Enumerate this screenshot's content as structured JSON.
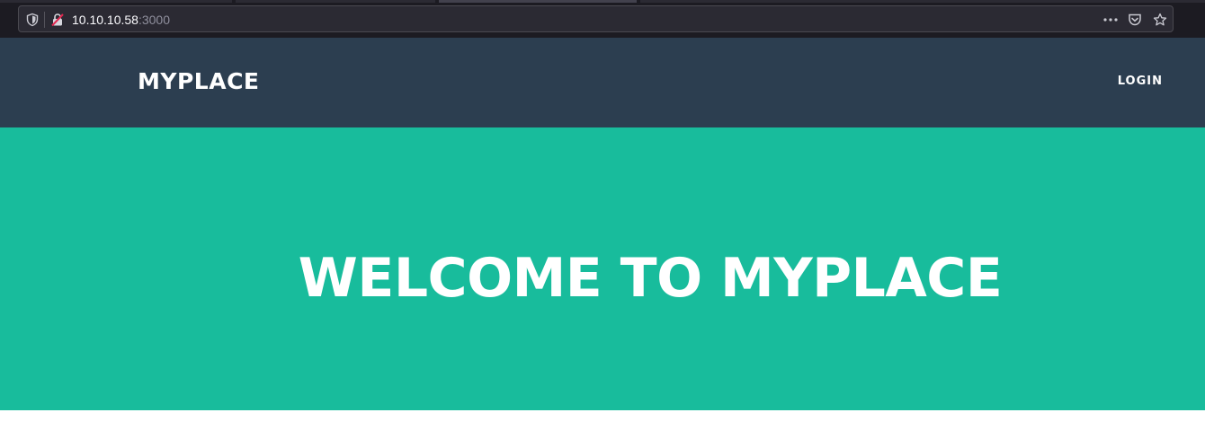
{
  "browser": {
    "url_host": "10.10.10.58",
    "url_port": ":3000",
    "icons": {
      "shield": "tracking-protection-shield-icon",
      "lock": "insecure-connection-lock-icon",
      "more": "page-actions-more-icon",
      "pocket": "pocket-save-icon",
      "star": "bookmark-star-icon"
    }
  },
  "nav": {
    "brand": "MYPLACE",
    "login_label": "LOGIN"
  },
  "hero": {
    "title": "WELCOME TO MYPLACE"
  },
  "colors": {
    "chrome": "#1c1b22",
    "urlbar": "#2b2a33",
    "nav_bg": "#2c3e50",
    "hero_bg": "#18bc9c",
    "text": "#ffffff",
    "insecure_lock": "#e22850"
  }
}
